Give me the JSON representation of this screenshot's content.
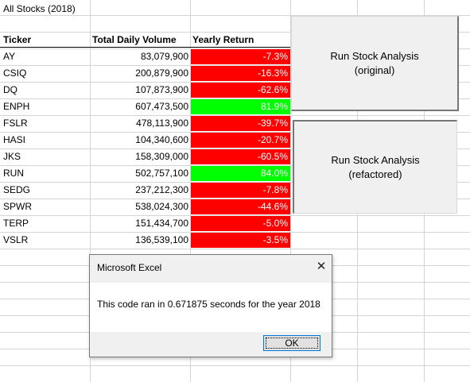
{
  "sheet": {
    "title": "All Stocks (2018)",
    "headers": {
      "ticker": "Ticker",
      "volume": "Total Daily Volume",
      "return": "Yearly Return"
    },
    "rows": [
      {
        "ticker": "AY",
        "volume": "83,079,900",
        "ret": "-7.3%",
        "status": "negative"
      },
      {
        "ticker": "CSIQ",
        "volume": "200,879,900",
        "ret": "-16.3%",
        "status": "negative"
      },
      {
        "ticker": "DQ",
        "volume": "107,873,900",
        "ret": "-62.6%",
        "status": "negative"
      },
      {
        "ticker": "ENPH",
        "volume": "607,473,500",
        "ret": "81.9%",
        "status": "positive"
      },
      {
        "ticker": "FSLR",
        "volume": "478,113,900",
        "ret": "-39.7%",
        "status": "negative"
      },
      {
        "ticker": "HASI",
        "volume": "104,340,600",
        "ret": "-20.7%",
        "status": "negative"
      },
      {
        "ticker": "JKS",
        "volume": "158,309,000",
        "ret": "-60.5%",
        "status": "negative"
      },
      {
        "ticker": "RUN",
        "volume": "502,757,100",
        "ret": "84.0%",
        "status": "positive"
      },
      {
        "ticker": "SEDG",
        "volume": "237,212,300",
        "ret": "-7.8%",
        "status": "negative"
      },
      {
        "ticker": "SPWR",
        "volume": "538,024,300",
        "ret": "-44.6%",
        "status": "negative"
      },
      {
        "ticker": "TERP",
        "volume": "151,434,700",
        "ret": "-5.0%",
        "status": "negative"
      },
      {
        "ticker": "VSLR",
        "volume": "136,539,100",
        "ret": "-3.5%",
        "status": "negative"
      }
    ]
  },
  "buttons": {
    "original": {
      "line1": "Run Stock Analysis",
      "line2": "(original)"
    },
    "refactored": {
      "line1": "Run Stock Analysis",
      "line2": "(refactored)"
    }
  },
  "dialog": {
    "title": "Microsoft Excel",
    "close": "✕",
    "message": "This code ran in 0.671875 seconds for the year 2018",
    "ok": "OK"
  },
  "colors": {
    "negative": "#ff0000",
    "positive": "#00ff00",
    "negative_text": "#ffffff",
    "positive_text": "#ffffff"
  }
}
